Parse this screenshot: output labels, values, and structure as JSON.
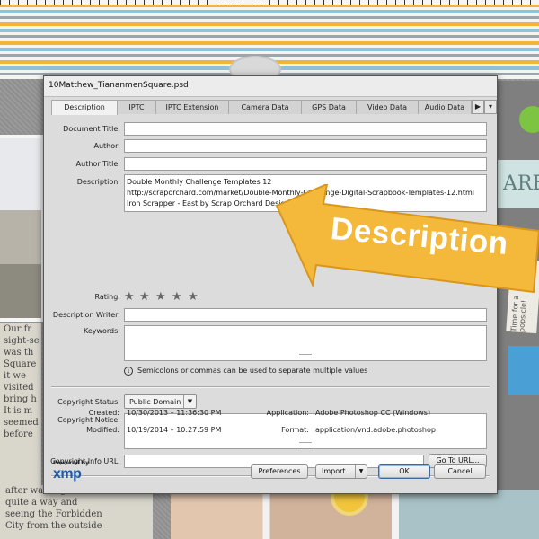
{
  "background": {
    "text_left": [
      "Our fr",
      "sight-se",
      "was th",
      "Square",
      "it we",
      "visited",
      "bring h",
      "It is m",
      "seemed",
      "before"
    ],
    "text_bottom": [
      "after walking",
      "quite a way and",
      "seeing the Forbidden",
      "City from the outside"
    ],
    "card_text": "ARE",
    "note_text": "Time for a popsicle!"
  },
  "dialog": {
    "title": "10Matthew_TiananmenSquare.psd",
    "tabs": [
      "Description",
      "IPTC",
      "IPTC Extension",
      "Camera Data",
      "GPS Data",
      "Video Data",
      "Audio Data"
    ],
    "active_tab": "Description"
  },
  "form": {
    "document_title": {
      "label": "Document Title:",
      "value": ""
    },
    "author": {
      "label": "Author:",
      "value": ""
    },
    "author_title": {
      "label": "Author Title:",
      "value": ""
    },
    "description": {
      "label": "Description:",
      "lines": [
        "Double Monthly Challenge Templates 12",
        "http://scraporchard.com/market/Double-Monthly-Challenge-Digital-Scrapbook-Templates-12.html",
        "Iron Scrapper - East by Scrap Orchard Designs"
      ]
    },
    "rating": {
      "label": "Rating:",
      "stars": 5
    },
    "description_writer": {
      "label": "Description Writer:",
      "value": ""
    },
    "keywords": {
      "label": "Keywords:",
      "value": ""
    },
    "keywords_note": "Semicolons or commas can be used to separate multiple values",
    "copyright_status": {
      "label": "Copyright Status:",
      "value": "Public Domain"
    },
    "copyright_notice": {
      "label": "Copyright Notice:",
      "value": ""
    },
    "copyright_url": {
      "label": "Copyright Info URL:",
      "value": ""
    },
    "go_to_url": "Go To URL..."
  },
  "meta": {
    "created_label": "Created:",
    "created_value": "10/30/2013 – 11:36:30 PM",
    "modified_label": "Modified:",
    "modified_value": "10/19/2014 – 10:27:59 PM",
    "application_label": "Application:",
    "application_value": "Adobe Photoshop CC (Windows)",
    "format_label": "Format:",
    "format_value": "application/vnd.adobe.photoshop"
  },
  "footer": {
    "powered_by": "Powered By",
    "logo_text": "xmp",
    "preferences": "Preferences",
    "import": "Import...",
    "ok": "OK",
    "cancel": "Cancel"
  },
  "callout": {
    "text": "Description",
    "color": "#f4b93a"
  }
}
